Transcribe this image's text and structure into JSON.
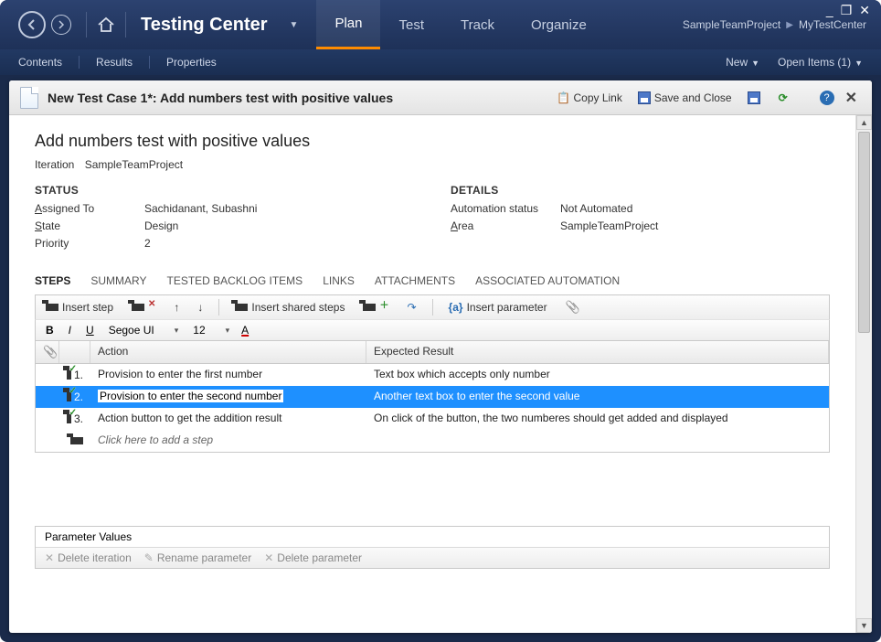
{
  "app": {
    "title": "Testing Center"
  },
  "win_controls": {
    "min": "_",
    "max": "❐",
    "close": "✕"
  },
  "ribbon_tabs": [
    {
      "label": "Plan",
      "active": true
    },
    {
      "label": "Test",
      "active": false
    },
    {
      "label": "Track",
      "active": false
    },
    {
      "label": "Organize",
      "active": false
    }
  ],
  "breadcrumb": {
    "project": "SampleTeamProject",
    "center": "MyTestCenter"
  },
  "sec_links": {
    "contents": "Contents",
    "results": "Results",
    "properties": "Properties"
  },
  "sec_right": {
    "new": "New",
    "open_items": "Open Items (1)"
  },
  "panel": {
    "title": "New Test Case 1*: Add numbers test with positive values",
    "copy_link": "Copy Link",
    "save_close": "Save and Close"
  },
  "testcase": {
    "heading": "Add numbers test with positive values",
    "iteration_label": "Iteration",
    "iteration_value": "SampleTeamProject",
    "status": {
      "head": "STATUS",
      "assigned_k": "Assigned To",
      "assigned_v": "Sachidanant, Subashni",
      "state_k": "State",
      "state_v": "Design",
      "priority_k": "Priority",
      "priority_v": "2"
    },
    "details": {
      "head": "DETAILS",
      "auto_k": "Automation status",
      "auto_v": "Not Automated",
      "area_k": "Area",
      "area_v": "SampleTeamProject"
    }
  },
  "tabs": {
    "steps": "STEPS",
    "summary": "SUMMARY",
    "backlog": "TESTED BACKLOG ITEMS",
    "links": "LINKS",
    "attachments": "ATTACHMENTS",
    "automation": "ASSOCIATED AUTOMATION"
  },
  "toolbar": {
    "insert_step": "Insert step",
    "insert_shared": "Insert shared steps",
    "insert_param": "Insert parameter"
  },
  "fmt": {
    "font": "Segoe UI",
    "size": "12"
  },
  "grid": {
    "col_action": "Action",
    "col_expected": "Expected Result",
    "rows": [
      {
        "num": "1.",
        "action": "Provision to enter the first number",
        "expected": "Text box which accepts only number"
      },
      {
        "num": "2.",
        "action": "Provision to enter the second number",
        "expected": "Another text box to enter the second value"
      },
      {
        "num": "3.",
        "action": "Action button to get the addition result",
        "expected": "On click of the button, the two numberes should get added and displayed"
      }
    ],
    "add_placeholder": "Click here to add a step"
  },
  "params": {
    "title": "Parameter Values",
    "delete_iter": "Delete iteration",
    "rename": "Rename parameter",
    "delete_param": "Delete parameter"
  }
}
